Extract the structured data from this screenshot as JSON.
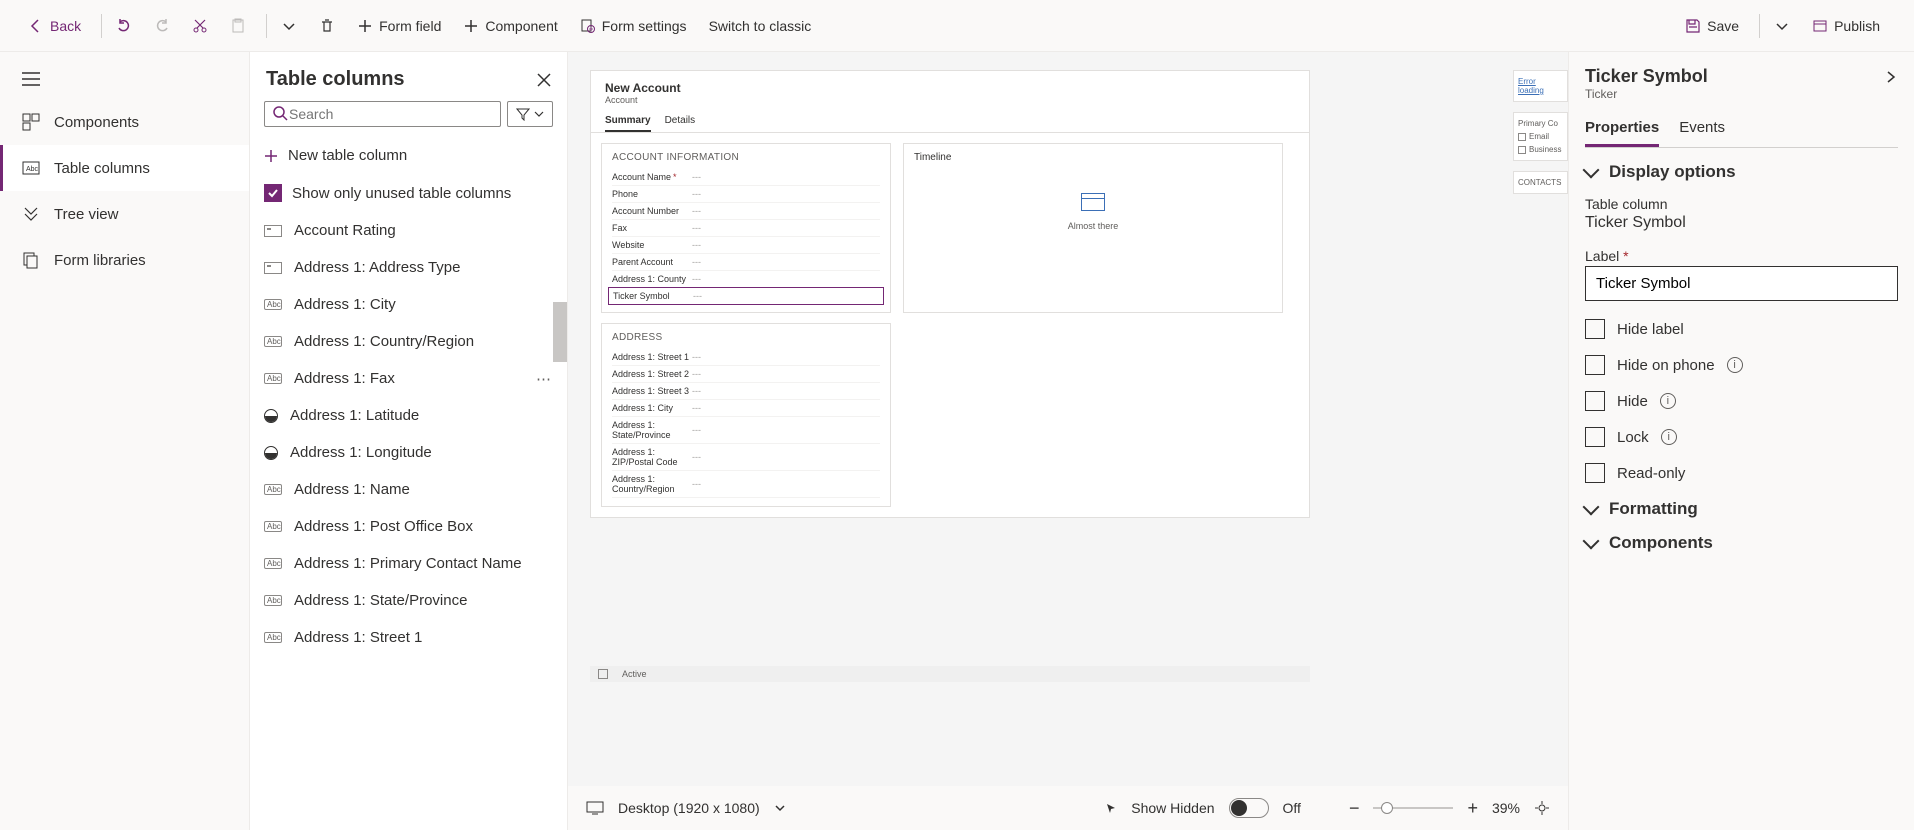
{
  "topbar": {
    "back": "Back",
    "form_field": "Form field",
    "component": "Component",
    "form_settings": "Form settings",
    "switch_classic": "Switch to classic",
    "save": "Save",
    "publish": "Publish"
  },
  "leftnav": {
    "components": "Components",
    "table_columns": "Table columns",
    "tree_view": "Tree view",
    "form_libraries": "Form libraries"
  },
  "tcol": {
    "title": "Table columns",
    "search_placeholder": "Search",
    "new_column": "New table column",
    "show_unused": "Show only unused table columns",
    "items": [
      {
        "label": "Account Rating",
        "type": "rect"
      },
      {
        "label": "Address 1: Address Type",
        "type": "rect"
      },
      {
        "label": "Address 1: City",
        "type": "abc"
      },
      {
        "label": "Address 1: Country/Region",
        "type": "abc"
      },
      {
        "label": "Address 1: Fax",
        "type": "abc",
        "hover": true
      },
      {
        "label": "Address 1: Latitude",
        "type": "globe"
      },
      {
        "label": "Address 1: Longitude",
        "type": "globe"
      },
      {
        "label": "Address 1: Name",
        "type": "abc"
      },
      {
        "label": "Address 1: Post Office Box",
        "type": "abc"
      },
      {
        "label": "Address 1: Primary Contact Name",
        "type": "abc"
      },
      {
        "label": "Address 1: State/Province",
        "type": "abc"
      },
      {
        "label": "Address 1: Street 1",
        "type": "abc"
      }
    ]
  },
  "form": {
    "title": "New Account",
    "entity": "Account",
    "tabs": {
      "summary": "Summary",
      "details": "Details"
    },
    "section1": {
      "title": "ACCOUNT INFORMATION",
      "fields": [
        {
          "label": "Account Name",
          "value": "---",
          "required": true
        },
        {
          "label": "Phone",
          "value": "---"
        },
        {
          "label": "Account Number",
          "value": "---"
        },
        {
          "label": "Fax",
          "value": "---"
        },
        {
          "label": "Website",
          "value": "---"
        },
        {
          "label": "Parent Account",
          "value": "---"
        },
        {
          "label": "Address 1: County",
          "value": "---"
        },
        {
          "label": "Ticker Symbol",
          "value": "---",
          "selected": true
        }
      ]
    },
    "timeline": {
      "title": "Timeline",
      "msg": "Almost there"
    },
    "section2": {
      "title": "ADDRESS",
      "fields": [
        {
          "label": "Address 1: Street 1",
          "value": "---"
        },
        {
          "label": "Address 1: Street 2",
          "value": "---"
        },
        {
          "label": "Address 1: Street 3",
          "value": "---"
        },
        {
          "label": "Address 1: City",
          "value": "---"
        },
        {
          "label": "Address 1: State/Province",
          "value": "---"
        },
        {
          "label": "Address 1: ZIP/Postal Code",
          "value": "---"
        },
        {
          "label": "Address 1: Country/Region",
          "value": "---"
        }
      ]
    },
    "status": "Active"
  },
  "thumbnails": {
    "err": "Error loading",
    "primary": "Primary Co",
    "email": "Email",
    "business": "Business",
    "contacts": "CONTACTS"
  },
  "footbar": {
    "viewport": "Desktop (1920 x 1080)",
    "show_hidden": "Show Hidden",
    "toggle_state": "Off",
    "zoom": "39%"
  },
  "prop": {
    "title": "Ticker Symbol",
    "subtitle": "Ticker",
    "tabs": {
      "properties": "Properties",
      "events": "Events"
    },
    "display_options": "Display options",
    "table_column_lbl": "Table column",
    "table_column_val": "Ticker Symbol",
    "label_lbl": "Label",
    "label_val": "Ticker Symbol",
    "hide_label": "Hide label",
    "hide_phone": "Hide on phone",
    "hide": "Hide",
    "lock": "Lock",
    "readonly": "Read-only",
    "formatting": "Formatting",
    "components": "Components"
  }
}
